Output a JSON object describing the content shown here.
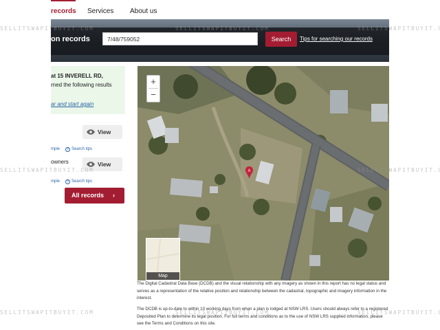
{
  "nav": {
    "items": [
      {
        "label": "records"
      },
      {
        "label": "Services"
      },
      {
        "label": "About us"
      }
    ]
  },
  "banner": {
    "title": "on records",
    "search_value": "7/48/759052",
    "search_button": "Search",
    "tips_link": "Tips for searching our records"
  },
  "infobox": {
    "line1": "at 15 INVERELL RD,",
    "line2": "rned the following results",
    "link": "ar and start again"
  },
  "records": [
    {
      "view_label": "View",
      "sample_label": "mple",
      "tips_label": "Search tips"
    },
    {
      "label": "owners",
      "view_label": "View",
      "sample_label": "mple",
      "tips_label": "Search tips"
    }
  ],
  "all_records": {
    "label": "All records"
  },
  "map": {
    "zoom_in": "+",
    "zoom_out": "−",
    "thumb_label": "Map",
    "marker_label": "A"
  },
  "disclaimer": {
    "p1": "The Digital Cadastral Data Base (DCDB) and the visual relationship with any imagery as shown in this report has no legal status and serves as a representation of the relative position and relationship between the cadastral, topographic and imagery information in the interest.",
    "p2": "The DCDB is up-to-date to within 10 working days from when a plan is lodged at NSW LRS. Users should always refer to a registered Deposited Plan to determine its legal position. For full terms and conditions as to the use of NSW LRS supplied information, please see the Terms and Conditions on this site."
  },
  "watermark": "SELLITSWAPITBUYIT.COM",
  "colors": {
    "accent": "#a31d32",
    "link": "#2a64a6",
    "info_bg": "#eaf7e9"
  }
}
